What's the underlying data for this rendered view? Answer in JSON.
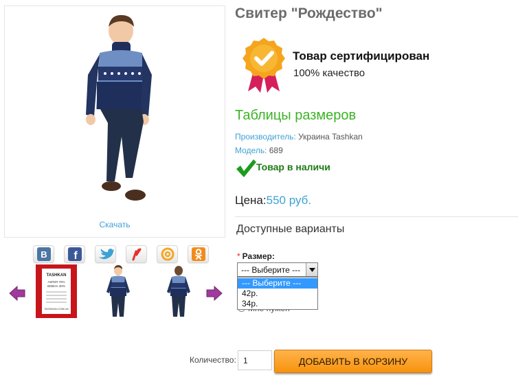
{
  "product": {
    "title": "Свитер \"Рождество\"",
    "download_label": "Скачать"
  },
  "certificate": {
    "title": "Товар сертифицирован",
    "subtitle": "100% качество"
  },
  "size_tables_link": "Таблицы размеров",
  "manufacturer": {
    "label": "Производитель:",
    "value": " Украина Tashkan"
  },
  "model": {
    "label": "Модель:",
    "value": " 689"
  },
  "stock": {
    "text": "Товар в наличи",
    "color": "#1d7a16"
  },
  "price": {
    "label": "Цена:",
    "value": "550 руб."
  },
  "options": {
    "heading": "Доступные варианты",
    "size": {
      "required_mark": "*",
      "label": "Размер:",
      "selected": "--- Выберите ---",
      "dropdown_options": [
        "--- Выберите ---",
        "42р.",
        "34р."
      ],
      "partially_hidden_option": "Мне нужен"
    }
  },
  "quantity": {
    "label": "Количество:",
    "value": "1"
  },
  "add_to_cart_label": "ДОБАВИТЬ В КОРЗИНУ",
  "social": [
    {
      "icon": "vk-icon"
    },
    {
      "icon": "facebook-icon"
    },
    {
      "icon": "twitter-icon"
    },
    {
      "icon": "surfingbird-icon"
    },
    {
      "icon": "mail-ru-icon"
    },
    {
      "icon": "odnoklassniki-icon"
    }
  ],
  "thumbnails": [
    {
      "label_lines": [
        "TASHKAN",
        "АКРИЛ 70%",
        "ВОВНА 30%",
        "TASHKAN.COM.UA"
      ]
    },
    {
      "subject": "boy-front"
    },
    {
      "subject": "boy-back"
    }
  ],
  "colors": {
    "accent_blue": "#3ea1d4",
    "size_link_green": "#3bb324",
    "cart_button": "#f7930e",
    "nav_arrow": "#a03a9c"
  }
}
